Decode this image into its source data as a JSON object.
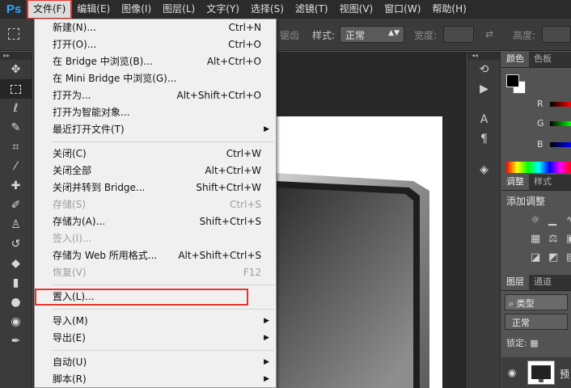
{
  "app": {
    "logo": "Ps"
  },
  "menubar": [
    {
      "label": "文件(F)",
      "active": true
    },
    {
      "label": "编辑(E)"
    },
    {
      "label": "图像(I)"
    },
    {
      "label": "图层(L)"
    },
    {
      "label": "文字(Y)"
    },
    {
      "label": "选择(S)"
    },
    {
      "label": "滤镜(T)"
    },
    {
      "label": "视图(V)"
    },
    {
      "label": "窗口(W)"
    },
    {
      "label": "帮助(H)"
    }
  ],
  "options": {
    "partial": "锯齿",
    "style_label": "样式:",
    "style_value": "正常",
    "width_label": "宽度:",
    "height_label": "高度:"
  },
  "file_menu": [
    {
      "label": "新建(N)...",
      "shortcut": "Ctrl+N"
    },
    {
      "label": "打开(O)...",
      "shortcut": "Ctrl+O"
    },
    {
      "label": "在 Bridge 中浏览(B)...",
      "shortcut": "Alt+Ctrl+O"
    },
    {
      "label": "在 Mini Bridge 中浏览(G)...",
      "shortcut": ""
    },
    {
      "label": "打开为...",
      "shortcut": "Alt+Shift+Ctrl+O"
    },
    {
      "label": "打开为智能对象...",
      "shortcut": ""
    },
    {
      "label": "最近打开文件(T)",
      "shortcut": "",
      "submenu": true
    },
    {
      "separator": true
    },
    {
      "label": "关闭(C)",
      "shortcut": "Ctrl+W"
    },
    {
      "label": "关闭全部",
      "shortcut": "Alt+Ctrl+W"
    },
    {
      "label": "关闭并转到 Bridge...",
      "shortcut": "Shift+Ctrl+W"
    },
    {
      "label": "存储(S)",
      "shortcut": "Ctrl+S",
      "disabled": true
    },
    {
      "label": "存储为(A)...",
      "shortcut": "Shift+Ctrl+S"
    },
    {
      "label": "签入(I)...",
      "shortcut": "",
      "disabled": true
    },
    {
      "label": "存储为 Web 所用格式...",
      "shortcut": "Alt+Shift+Ctrl+S"
    },
    {
      "label": "恢复(V)",
      "shortcut": "F12",
      "disabled": true
    },
    {
      "separator": true
    },
    {
      "label": "置入(L)...",
      "shortcut": "",
      "highlight": true
    },
    {
      "separator": true
    },
    {
      "label": "导入(M)",
      "shortcut": "",
      "submenu": true
    },
    {
      "label": "导出(E)",
      "shortcut": "",
      "submenu": true
    },
    {
      "separator": true
    },
    {
      "label": "自动(U)",
      "shortcut": "",
      "submenu": true
    },
    {
      "label": "脚本(R)",
      "shortcut": "",
      "submenu": true
    }
  ],
  "panels": {
    "color_tabs": [
      "颜色",
      "色板"
    ],
    "rgb": [
      "R",
      "G",
      "B"
    ],
    "adjust_tabs": [
      "调整",
      "样式"
    ],
    "adjust_title": "添加调整",
    "layers_tabs": [
      "图层",
      "通道"
    ],
    "layers_kind": "类型",
    "blend_mode": "正常",
    "lock_label": "锁定:",
    "layer_name": "预"
  },
  "icons": {
    "move": "move-icon",
    "marquee": "marquee-icon",
    "lasso": "lasso-icon",
    "quick_select": "quick-select-icon",
    "crop": "crop-icon",
    "eyedropper": "eyedropper-icon",
    "healing": "healing-brush-icon",
    "brush": "brush-icon",
    "stamp": "clone-stamp-icon",
    "history_brush": "history-brush-icon",
    "eraser": "eraser-icon",
    "gradient": "gradient-icon",
    "blur": "blur-icon",
    "dodge": "dodge-icon",
    "pen": "pen-icon"
  },
  "colors": {
    "highlight": "#e8332d",
    "ps_blue": "#31a8ff"
  }
}
